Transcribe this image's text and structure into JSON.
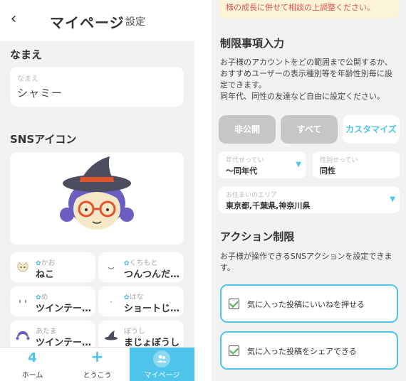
{
  "left": {
    "header": {
      "back_icon": "‹",
      "title": "マイページ",
      "settings_label": "設定"
    },
    "name_section": {
      "label": "なまえ",
      "field_placeholder": "なまえ",
      "field_value": "シャミー"
    },
    "icon_section": {
      "label": "SNSアイコン"
    },
    "parts": [
      {
        "label": "かお",
        "value": "ねこ",
        "icon": "cat-face-icon"
      },
      {
        "label": "くちもと",
        "value": "つんつんだ…",
        "icon": "mouth-icon"
      },
      {
        "label": "め",
        "value": "ツインテー…",
        "icon": "eyes-icon"
      },
      {
        "label": "はな",
        "value": "ショートじ…",
        "icon": "nose-icon"
      },
      {
        "label": "あたま",
        "value": "ツインテー…",
        "icon": "hair-icon"
      },
      {
        "label": "ぼうし",
        "value": "まじょぼうし",
        "icon": "witch-hat-icon"
      }
    ],
    "tabs": [
      {
        "label": "ホーム",
        "icon": "4"
      },
      {
        "label": "とうこう",
        "icon": "+"
      },
      {
        "label": "マイページ",
        "icon": "people-icon",
        "active": true
      }
    ],
    "colors": {
      "accent": "#4fc4ea",
      "background": "#f2f2f2"
    }
  },
  "right": {
    "notice": "様の成長に併せて相談の上調整ください。",
    "restrictions": {
      "heading": "制限事項入力",
      "description": [
        "お子様のアカウントをどの範囲まで公開するか、",
        "おすすめユーザーの表示種別等を年齢性別毎に設",
        "定できます。",
        "同年代、同性の友達など自由に設定ください。"
      ],
      "visibility_options": [
        {
          "label": "非公開",
          "selected": false
        },
        {
          "label": "すべて",
          "selected": false
        },
        {
          "label": "カスタマイズ",
          "selected": true
        }
      ],
      "age_field": {
        "placeholder": "年代せってい",
        "value": "〜同年代"
      },
      "gender_field": {
        "placeholder": "性別せってい",
        "value": "同性"
      },
      "area_field": {
        "placeholder": "お住まいのエリア",
        "value": "東京都,千葉県,神奈川県"
      }
    },
    "actions": {
      "heading": "アクション制限",
      "description": [
        "お子様が操作できるSNSアクションを設定できま",
        "す。"
      ],
      "items": [
        {
          "label": "気に入った投稿にいいねを押せる",
          "checked": true
        },
        {
          "label": "気に入った投稿をシェアできる",
          "checked": true
        }
      ]
    }
  }
}
